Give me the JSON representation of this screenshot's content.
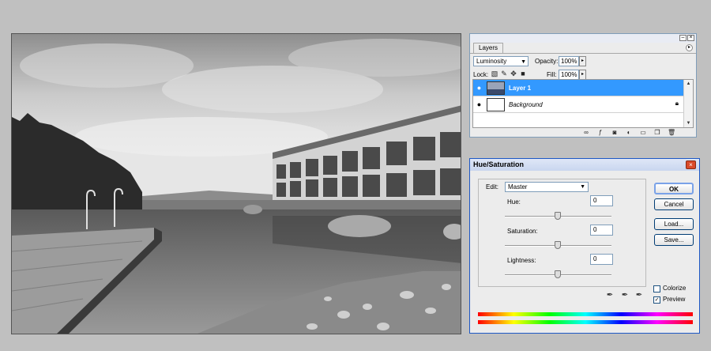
{
  "layers_panel": {
    "tab_label": "Layers",
    "blend_mode": "Luminosity",
    "opacity_label": "Opacity:",
    "opacity_value": "100%",
    "lock_label": "Lock:",
    "fill_label": "Fill:",
    "fill_value": "100%",
    "layers": [
      {
        "name": "Layer 1",
        "selected": true,
        "locked": false
      },
      {
        "name": "Background",
        "selected": false,
        "locked": true
      }
    ]
  },
  "hue_saturation": {
    "title": "Hue/Saturation",
    "edit_label": "Edit:",
    "edit_value": "Master",
    "hue_label": "Hue:",
    "hue_value": "0",
    "saturation_label": "Saturation:",
    "saturation_value": "0",
    "lightness_label": "Lightness:",
    "lightness_value": "0",
    "ok_label": "OK",
    "cancel_label": "Cancel",
    "load_label": "Load...",
    "save_label": "Save...",
    "colorize_label": "Colorize",
    "colorize_checked": false,
    "preview_label": "Preview",
    "preview_checked": true
  }
}
